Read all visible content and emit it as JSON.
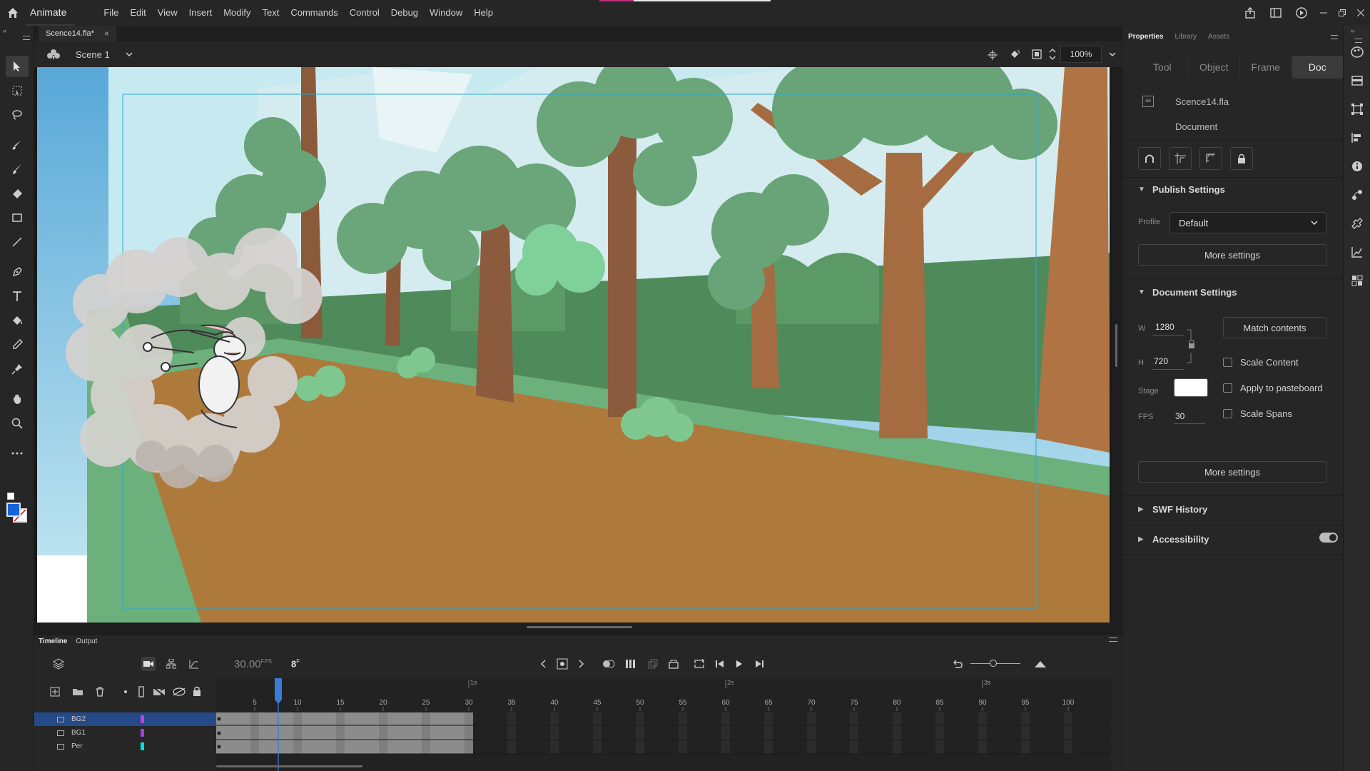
{
  "app": {
    "name": "Animate"
  },
  "menu": [
    "File",
    "Edit",
    "View",
    "Insert",
    "Modify",
    "Text",
    "Commands",
    "Control",
    "Debug",
    "Window",
    "Help"
  ],
  "document_tab": {
    "title": "Scence14.fla*"
  },
  "scene": {
    "name": "Scene 1",
    "zoom": "100%"
  },
  "timeline": {
    "tabs": [
      "Timeline",
      "Output"
    ],
    "fps": "30.00",
    "fps_unit": "FPS",
    "current_frame": "8",
    "frame_unit": "F",
    "ruler_marks": [
      "5",
      "10",
      "15",
      "20",
      "25",
      "30",
      "35",
      "40",
      "45",
      "50",
      "55",
      "60",
      "65",
      "70",
      "75",
      "80",
      "85",
      "90",
      "95",
      "100"
    ],
    "second_marks": [
      "1s",
      "2s",
      "3s"
    ],
    "layers": [
      {
        "name": "BG2",
        "color": "#c040e0",
        "selected": true
      },
      {
        "name": "BG1",
        "color": "#a040e0",
        "selected": false
      },
      {
        "name": "Per",
        "color": "#00e0e0",
        "selected": false
      }
    ]
  },
  "panel": {
    "tabs": [
      "Properties",
      "Library",
      "Assets"
    ],
    "segments": [
      "Tool",
      "Object",
      "Frame",
      "Doc"
    ],
    "active_segment": "Doc",
    "doc_name": "Scence14.fla",
    "doc_type": "Document",
    "publish_settings": {
      "title": "Publish Settings",
      "profile_label": "Profile",
      "profile_value": "Default",
      "more_settings": "More settings"
    },
    "document_settings": {
      "title": "Document Settings",
      "w_label": "W",
      "w_value": "1280",
      "h_label": "H",
      "h_value": "720",
      "match_contents": "Match contents",
      "stage_label": "Stage",
      "stage_color": "#ffffff",
      "fps_label": "FPS",
      "fps_value": "30",
      "scale_content": "Scale Content",
      "apply_pasteboard": "Apply to pasteboard",
      "scale_spans": "Scale Spans",
      "more_settings": "More settings"
    },
    "swf_history": "SWF History",
    "accessibility": "Accessibility"
  },
  "colors": {
    "stroke": "#1565d8",
    "fill": "#ffffff",
    "selected_layer": "#264a87",
    "playhead": "#3a7bd5"
  }
}
